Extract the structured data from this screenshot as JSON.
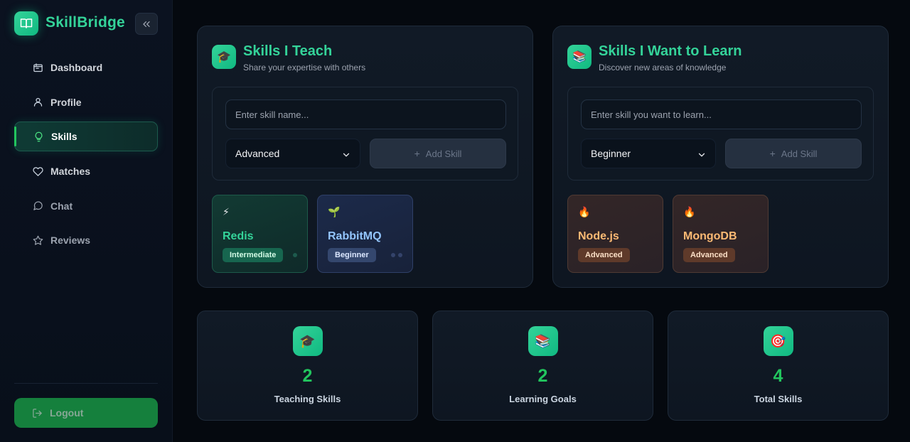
{
  "brand": {
    "name": "SkillBridge",
    "logo_icon": "book-icon",
    "accent": "#34d399"
  },
  "sidebar": {
    "items": [
      {
        "label": "Dashboard",
        "icon": "dashboard-icon",
        "active": false
      },
      {
        "label": "Profile",
        "icon": "user-icon",
        "active": false
      },
      {
        "label": "Skills",
        "icon": "lightbulb-icon",
        "active": true
      },
      {
        "label": "Matches",
        "icon": "heart-icon",
        "active": false
      },
      {
        "label": "Chat",
        "icon": "chat-icon",
        "active": false
      },
      {
        "label": "Reviews",
        "icon": "star-icon",
        "active": false
      }
    ],
    "logout_label": "Logout"
  },
  "teach": {
    "icon": "🎓",
    "title": "Skills I Teach",
    "subtitle": "Share your expertise with others",
    "input_placeholder": "Enter skill name...",
    "level": "Advanced",
    "add_label": "Add Skill",
    "skills": [
      {
        "emoji": "⚡",
        "name": "Redis",
        "level": "Intermediate"
      },
      {
        "emoji": "🌱",
        "name": "RabbitMQ",
        "level": "Beginner"
      }
    ]
  },
  "learn": {
    "icon": "📚",
    "title": "Skills I Want to Learn",
    "subtitle": "Discover new areas of knowledge",
    "input_placeholder": "Enter skill you want to learn...",
    "level": "Beginner",
    "add_label": "Add Skill",
    "skills": [
      {
        "emoji": "🔥",
        "name": "Node.js",
        "level": "Advanced"
      },
      {
        "emoji": "🔥",
        "name": "MongoDB",
        "level": "Advanced"
      }
    ]
  },
  "stats": [
    {
      "icon": "🎓",
      "value": "2",
      "label": "Teaching Skills"
    },
    {
      "icon": "📚",
      "value": "2",
      "label": "Learning Goals"
    },
    {
      "icon": "🎯",
      "value": "4",
      "label": "Total Skills"
    }
  ]
}
